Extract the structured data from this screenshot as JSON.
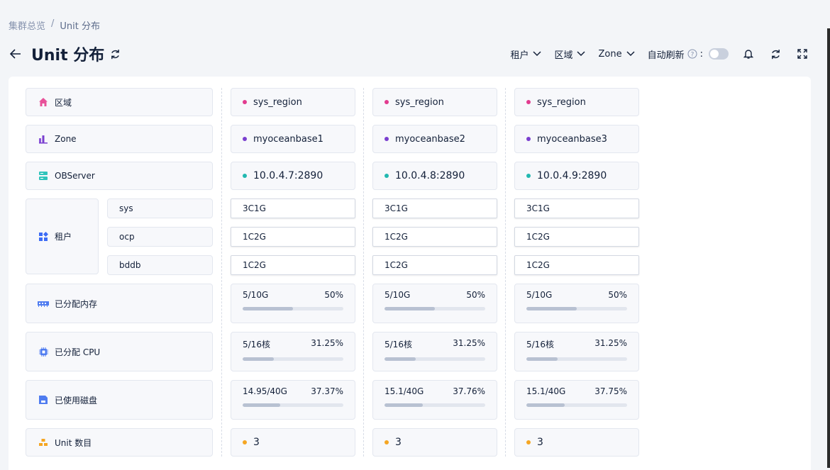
{
  "breadcrumb": {
    "root": "集群总览",
    "sep": "/",
    "current": "Unit 分布"
  },
  "header": {
    "title": "Unit 分布"
  },
  "toolbar": {
    "filters": [
      "租户",
      "区域",
      "Zone"
    ],
    "auto_refresh_label": "自动刷新",
    "colon": ":"
  },
  "colors": {
    "region": "#e23b8f",
    "zone": "#7a3fcf",
    "server": "#22b8b0",
    "unit": "#f5a623"
  },
  "labels": {
    "region": "区域",
    "zone": "Zone",
    "observer": "OBServer",
    "tenant": "租户",
    "tenants": [
      "sys",
      "ocp",
      "bddb"
    ],
    "memory": "已分配内存",
    "cpu": "已分配 CPU",
    "disk": "已使用磁盘",
    "unit_count": "Unit 数目"
  },
  "servers": [
    {
      "region": "sys_region",
      "zone": "myoceanbase1",
      "observer": "10.0.4.7:2890",
      "tenant_units": [
        "3C1G",
        "1C2G",
        "1C2G"
      ],
      "memory": {
        "used": "5/10G",
        "pct": "50%",
        "ratio": 0.5
      },
      "cpu": {
        "used": "5/16核",
        "pct": "31.25%",
        "ratio": 0.3125
      },
      "disk": {
        "used": "14.95/40G",
        "pct": "37.37%",
        "ratio": 0.3737
      },
      "unit_count": "3"
    },
    {
      "region": "sys_region",
      "zone": "myoceanbase2",
      "observer": "10.0.4.8:2890",
      "tenant_units": [
        "3C1G",
        "1C2G",
        "1C2G"
      ],
      "memory": {
        "used": "5/10G",
        "pct": "50%",
        "ratio": 0.5
      },
      "cpu": {
        "used": "5/16核",
        "pct": "31.25%",
        "ratio": 0.3125
      },
      "disk": {
        "used": "15.1/40G",
        "pct": "37.76%",
        "ratio": 0.3776
      },
      "unit_count": "3"
    },
    {
      "region": "sys_region",
      "zone": "myoceanbase3",
      "observer": "10.0.4.9:2890",
      "tenant_units": [
        "3C1G",
        "1C2G",
        "1C2G"
      ],
      "memory": {
        "used": "5/10G",
        "pct": "50%",
        "ratio": 0.5
      },
      "cpu": {
        "used": "5/16核",
        "pct": "31.25%",
        "ratio": 0.3125
      },
      "disk": {
        "used": "15.1/40G",
        "pct": "37.75%",
        "ratio": 0.3775
      },
      "unit_count": "3"
    }
  ]
}
